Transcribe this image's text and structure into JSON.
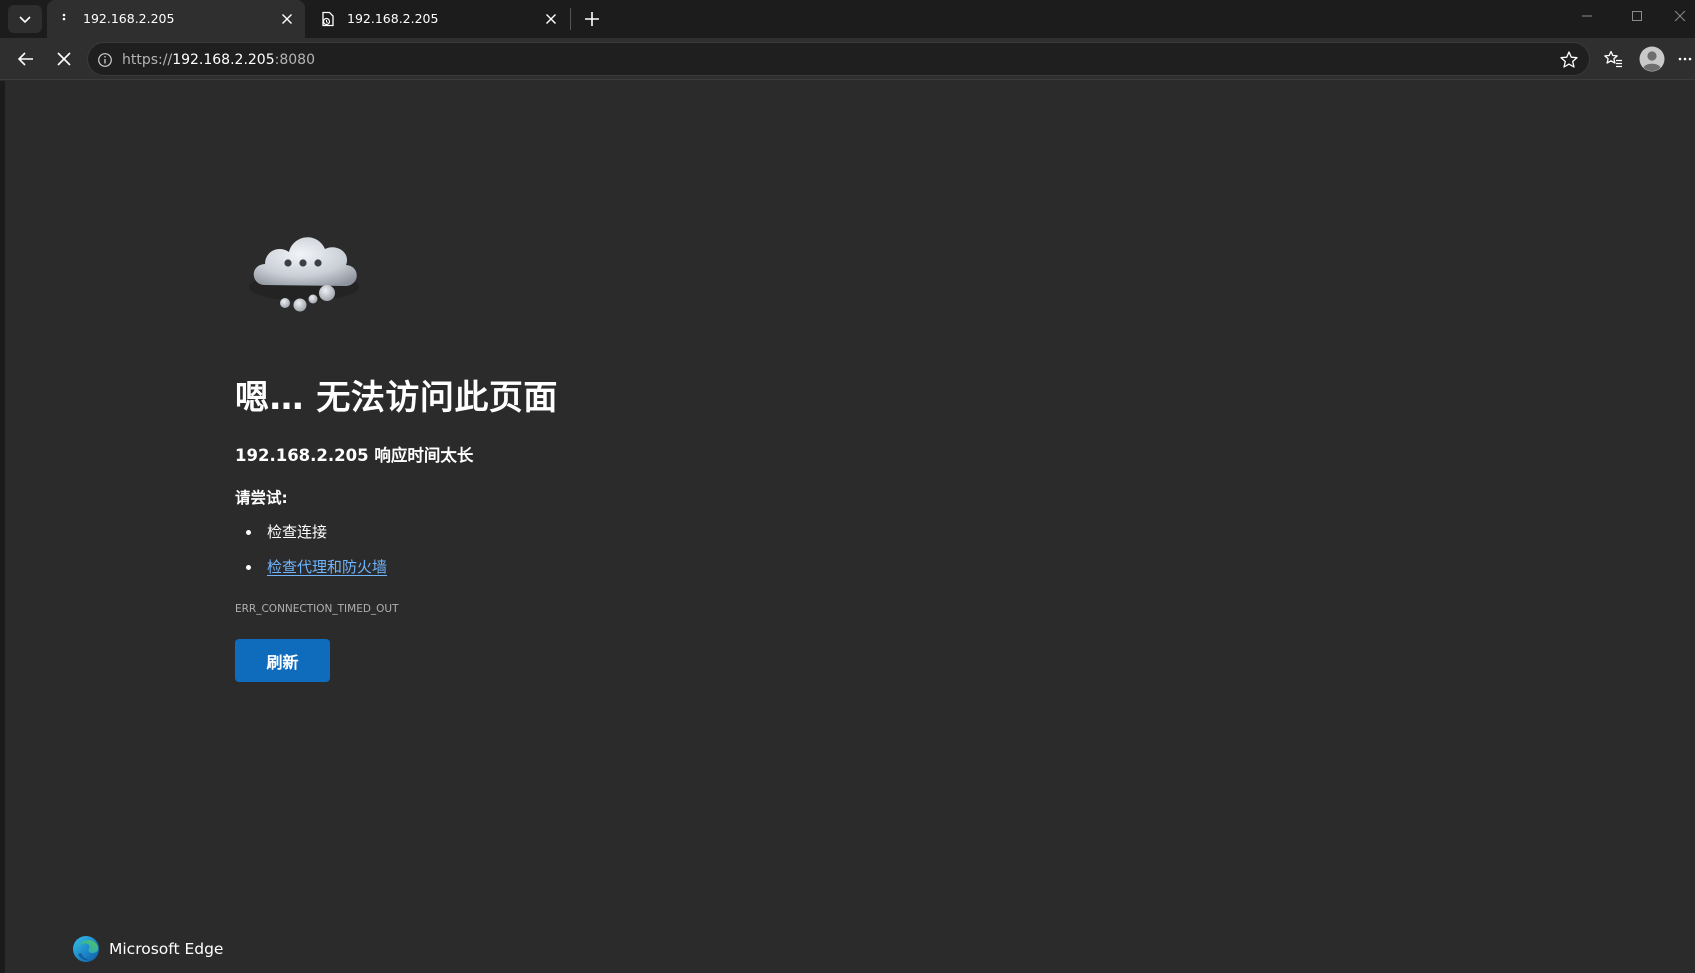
{
  "browser": {
    "tabs": [
      {
        "title": "192.168.2.205",
        "active": true,
        "favicon": "loading-dots-icon"
      },
      {
        "title": "192.168.2.205",
        "active": false,
        "favicon": "document-error-icon"
      }
    ],
    "address": {
      "scheme": "https://",
      "host": "192.168.2.205",
      "port": ":8080"
    },
    "icons": {
      "tab_actions": "chevron-down-icon",
      "new_tab": "plus-icon",
      "back": "arrow-left-icon",
      "stop": "close-icon",
      "site_info": "info-circle-icon",
      "favorite_add": "star-icon",
      "favorites": "favorites-list-icon",
      "profile": "user-avatar-icon",
      "more": "more-dots-icon",
      "minimize": "minimize-icon",
      "maximize": "maximize-icon",
      "close_window": "close-window-icon"
    }
  },
  "error_page": {
    "heading": "嗯… 无法访问此页面",
    "subheading": "192.168.2.205 响应时间太长",
    "try_label": "请尝试:",
    "suggestions": [
      {
        "text": "检查连接",
        "is_link": false
      },
      {
        "text": "检查代理和防火墙",
        "is_link": true
      }
    ],
    "error_code": "ERR_CONNECTION_TIMED_OUT",
    "refresh_label": "刷新",
    "brand_name": "Microsoft Edge"
  },
  "colors": {
    "page_bg": "#2b2b2b",
    "chrome_bg": "#1c1c1c",
    "toolbar_bg": "#2f2f2f",
    "link": "#6fb4ff",
    "accent_button": "#0f6cbd",
    "error_code_text": "#b0b0b0"
  }
}
